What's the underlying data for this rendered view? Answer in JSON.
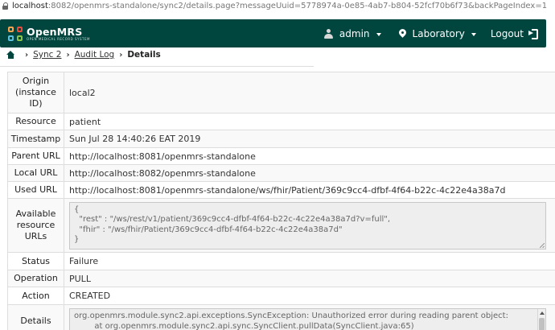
{
  "browser": {
    "url_host": "localhost",
    "url_rest": ":8082/openmrs-standalone/sync2/details.page?messageUuid=5778974a-0e85-4ab7-b804-52fcf70b6f73&backPageIndex=1"
  },
  "header": {
    "brand": "OpenMRS",
    "tagline": "OPEN MEDICAL RECORD SYSTEM",
    "user": "admin",
    "location": "Laboratory",
    "logout": "Logout",
    "background_color": "#00463f"
  },
  "breadcrumb": {
    "home_icon": "home-icon",
    "items": [
      "Sync 2",
      "Audit Log"
    ],
    "current": "Details"
  },
  "details": {
    "origin": {
      "label": "Origin (instance ID)",
      "value": "local2"
    },
    "resource": {
      "label": "Resource",
      "value": "patient"
    },
    "timestamp": {
      "label": "Timestamp",
      "value": "Sun Jul 28 14:40:26 EAT 2019"
    },
    "parent_url": {
      "label": "Parent URL",
      "value": "http://localhost:8081/openmrs-standalone"
    },
    "local_url": {
      "label": "Local URL",
      "value": "http://localhost:8082/openmrs-standalone"
    },
    "used_url": {
      "label": "Used URL",
      "value": "http://localhost:8081/openmrs-standalone/ws/fhir/Patient/369c9cc4-dfbf-4f64-b22c-4c22e4a38a7d"
    },
    "available_urls": {
      "label": "Available resource URLs",
      "value": "{\n  \"rest\" : \"/ws/rest/v1/patient/369c9cc4-dfbf-4f64-b22c-4c22e4a38a7d?v=full\",\n  \"fhir\" : \"/ws/fhir/Patient/369c9cc4-dfbf-4f64-b22c-4c22e4a38a7d\"\n}"
    },
    "status": {
      "label": "Status",
      "value": "Failure"
    },
    "operation": {
      "label": "Operation",
      "value": "PULL"
    },
    "action": {
      "label": "Action",
      "value": "CREATED"
    },
    "details": {
      "label": "Details",
      "value": "org.openmrs.module.sync2.api.exceptions.SyncException: Unauthorized error during reading parent object:\n        at org.openmrs.module.sync2.api.sync.SyncClient.pullData(SyncClient.java:65)"
    }
  }
}
